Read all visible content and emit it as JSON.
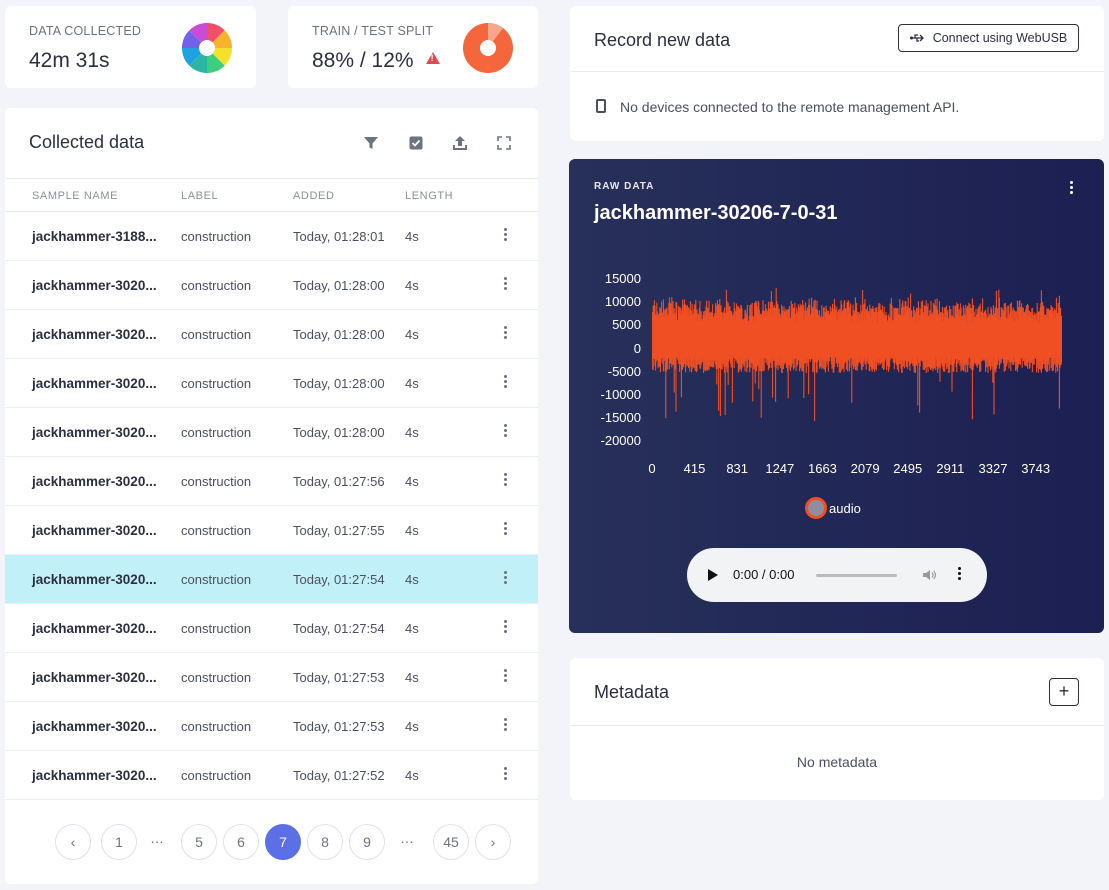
{
  "stats": {
    "collected": {
      "label": "DATA COLLECTED",
      "value": "42m 31s"
    },
    "split": {
      "label": "TRAIN / TEST SPLIT",
      "value": "88% / 12%"
    }
  },
  "colors": {
    "accent": "#5b6fe6",
    "waveform": "#f04f23",
    "selected_row": "#c2f0f8",
    "raw_bg": "#1f2454",
    "warning": "#e5484d"
  },
  "collected": {
    "title": "Collected data",
    "toolbar_icons": [
      "filter-icon",
      "select-checkbox-icon",
      "upload-icon",
      "expand-icon"
    ],
    "columns": {
      "name": "SAMPLE NAME",
      "label": "LABEL",
      "added": "ADDED",
      "length": "LENGTH"
    },
    "rows": [
      {
        "name": "jackhammer-3188...",
        "label": "construction",
        "added": "Today, 01:28:01",
        "length": "4s"
      },
      {
        "name": "jackhammer-3020...",
        "label": "construction",
        "added": "Today, 01:28:00",
        "length": "4s"
      },
      {
        "name": "jackhammer-3020...",
        "label": "construction",
        "added": "Today, 01:28:00",
        "length": "4s"
      },
      {
        "name": "jackhammer-3020...",
        "label": "construction",
        "added": "Today, 01:28:00",
        "length": "4s"
      },
      {
        "name": "jackhammer-3020...",
        "label": "construction",
        "added": "Today, 01:28:00",
        "length": "4s"
      },
      {
        "name": "jackhammer-3020...",
        "label": "construction",
        "added": "Today, 01:27:56",
        "length": "4s"
      },
      {
        "name": "jackhammer-3020...",
        "label": "construction",
        "added": "Today, 01:27:55",
        "length": "4s"
      },
      {
        "name": "jackhammer-3020...",
        "label": "construction",
        "added": "Today, 01:27:54",
        "length": "4s",
        "selected": true
      },
      {
        "name": "jackhammer-3020...",
        "label": "construction",
        "added": "Today, 01:27:54",
        "length": "4s"
      },
      {
        "name": "jackhammer-3020...",
        "label": "construction",
        "added": "Today, 01:27:53",
        "length": "4s"
      },
      {
        "name": "jackhammer-3020...",
        "label": "construction",
        "added": "Today, 01:27:53",
        "length": "4s"
      },
      {
        "name": "jackhammer-3020...",
        "label": "construction",
        "added": "Today, 01:27:52",
        "length": "4s"
      }
    ],
    "pagination": {
      "pages": [
        "1",
        "…",
        "5",
        "6",
        "7",
        "8",
        "9",
        "…",
        "45"
      ],
      "current": "7"
    }
  },
  "record": {
    "title": "Record new data",
    "connect_button": "Connect using WebUSB",
    "status": "No devices connected to the remote management API."
  },
  "raw": {
    "section_label": "RAW DATA",
    "sample_name": "jackhammer-30206-7-0-31",
    "legend": "audio",
    "audio_time": "0:00 / 0:00"
  },
  "chart_data": {
    "type": "line",
    "series": [
      {
        "name": "audio"
      }
    ],
    "x_ticks": [
      "0",
      "415",
      "831",
      "1247",
      "1663",
      "2079",
      "2495",
      "2911",
      "3327",
      "3743"
    ],
    "y_ticks": [
      "15000",
      "10000",
      "5000",
      "0",
      "-5000",
      "-10000",
      "-15000",
      "-20000"
    ],
    "ylim": [
      -20000,
      15000
    ],
    "xlim": [
      0,
      4000
    ],
    "grid": false,
    "legend_position": "bottom"
  },
  "metadata": {
    "title": "Metadata",
    "empty": "No metadata"
  }
}
